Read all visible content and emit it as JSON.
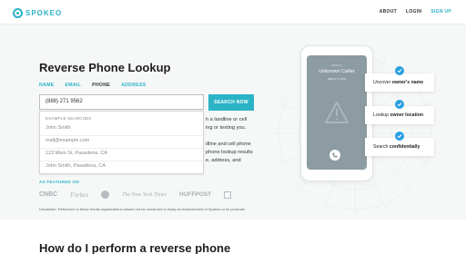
{
  "header": {
    "brand": "SPOKEO",
    "nav": [
      "ABOUT",
      "LOGIN",
      "SIGN UP"
    ]
  },
  "hero": {
    "title": "Reverse Phone Lookup",
    "tabs": [
      "NAME",
      "EMAIL",
      "PHONE",
      "ADDRESS"
    ],
    "active_tab": "PHONE",
    "search": {
      "value": "(888) 271 9562",
      "button": "SEARCH NOW"
    },
    "dropdown": {
      "heading": "EXAMPLE SEARCHES",
      "items": [
        "John Smith",
        "mail@example.com",
        "123 Main St, Pasadena, CA",
        "John Smith, Pasadena, CA"
      ]
    },
    "partial_text": [
      "h a landline or cell",
      "ing or texting you.",
      "dline and cell phone",
      "phone lookup results",
      "e, address, and"
    ],
    "featured_label": "AS FEATURED ON",
    "media_logos": [
      "CNBC",
      "Forbes",
      "The New York Times",
      "HUFFPOST"
    ],
    "disclaimer": "Disclaimer: Reference to these media organizations should not be construed to imply an endorsement of Spokeo or its products."
  },
  "phone": {
    "call_from": "Call From",
    "caller": "Unknown Caller",
    "number": "(888) 271 9562"
  },
  "callouts": [
    {
      "pre": "Uncover ",
      "bold": "owner's name"
    },
    {
      "pre": "Lookup ",
      "bold": "owner location"
    },
    {
      "pre": "Search ",
      "bold": "confidentially"
    }
  ],
  "bottom_heading": "How do I perform a reverse phone",
  "colors": {
    "accent": "#2bb3c6",
    "check_blue": "#2a9fe0",
    "phone_screen": "#8d9ba2"
  }
}
